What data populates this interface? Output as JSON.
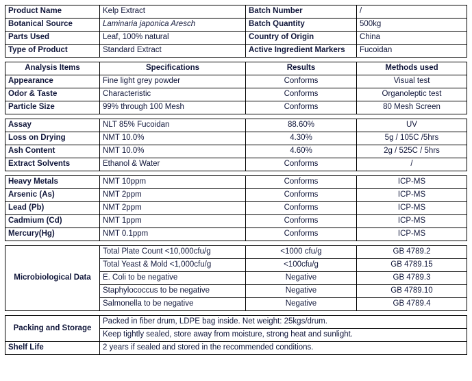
{
  "product_info": {
    "rows": [
      {
        "label_left": "Product Name",
        "value_left": "Kelp Extract",
        "label_right": "Batch Number",
        "value_right": "/",
        "italic_left": false
      },
      {
        "label_left": "Botanical Source",
        "value_left": "Laminaria japonica Aresch",
        "label_right": "Batch Quantity",
        "value_right": "500kg",
        "italic_left": true
      },
      {
        "label_left": "Parts Used",
        "value_left": "Leaf, 100% natural",
        "label_right": "Country of Origin",
        "value_right": "China",
        "italic_left": false
      },
      {
        "label_left": "Type of Product",
        "value_left": "Standard Extract",
        "label_right": "Active Ingredient Markers",
        "value_right": "Fucoidan",
        "italic_left": false
      }
    ]
  },
  "analysis": {
    "headers": {
      "items": "Analysis Items",
      "specifications": "Specifications",
      "results": "Results",
      "methods": "Methods used"
    },
    "organoleptic_rows": [
      {
        "item": "Appearance",
        "spec": "Fine light grey powder",
        "result": "Conforms",
        "method": "Visual test"
      },
      {
        "item": "Odor & Taste",
        "spec": "Characteristic",
        "result": "Conforms",
        "method": "Organoleptic test"
      },
      {
        "item": "Particle Size",
        "spec": "99% through 100 Mesh",
        "result": "Conforms",
        "method": "80 Mesh Screen"
      }
    ],
    "chemical_rows": [
      {
        "item": "Assay",
        "spec": "NLT 85% Fucoidan",
        "result": "88.60%",
        "method": "UV"
      },
      {
        "item": "Loss on Drying",
        "spec": "NMT 10.0%",
        "result": "4.30%",
        "method": "5g / 105C /5hrs"
      },
      {
        "item": "Ash Content",
        "spec": "NMT 10.0%",
        "result": "4.60%",
        "method": "2g / 525C / 5hrs"
      },
      {
        "item": "Extract Solvents",
        "spec": "Ethanol & Water",
        "result": "Conforms",
        "method": "/"
      }
    ],
    "heavy_metal_rows": [
      {
        "item": "Heavy Metals",
        "spec": "NMT 10ppm",
        "result": "Conforms",
        "method": "ICP-MS"
      },
      {
        "item": "Arsenic (As)",
        "spec": "NMT 2ppm",
        "result": "Conforms",
        "method": "ICP-MS"
      },
      {
        "item": "Lead (Pb)",
        "spec": "NMT 2ppm",
        "result": "Conforms",
        "method": "ICP-MS"
      },
      {
        "item": "Cadmium (Cd)",
        "spec": "NMT 1ppm",
        "result": "Conforms",
        "method": "ICP-MS"
      },
      {
        "item": "Mercury(Hg)",
        "spec": "NMT 0.1ppm",
        "result": "Conforms",
        "method": "ICP-MS"
      }
    ],
    "microbiological": {
      "group_label": "Microbiological Data",
      "rows": [
        {
          "spec": "Total Plate Count <10,000cfu/g",
          "result": "<1000 cfu/g",
          "method": "GB 4789.2"
        },
        {
          "spec": "Total Yeast & Mold <1,000cfu/g",
          "result": "<100cfu/g",
          "method": "GB 4789.15"
        },
        {
          "spec": "E. Coli to be negative",
          "result": "Negative",
          "method": "GB 4789.3"
        },
        {
          "spec": "Staphylococcus to be negative",
          "result": "Negative",
          "method": "GB 4789.10"
        },
        {
          "spec": "Salmonella to  be negative",
          "result": "Negative",
          "method": "GB 4789.4"
        }
      ]
    }
  },
  "footer": {
    "packing_label": "Packing and Storage",
    "packing_line_1": "Packed in fiber drum, LDPE bag inside. Net weight: 25kgs/drum.",
    "packing_line_2": "Keep tightly sealed, store away from moisture, strong heat and sunlight.",
    "shelf_life_label": "Shelf Life",
    "shelf_life_value": "2 years if sealed and stored in the recommended conditions."
  }
}
